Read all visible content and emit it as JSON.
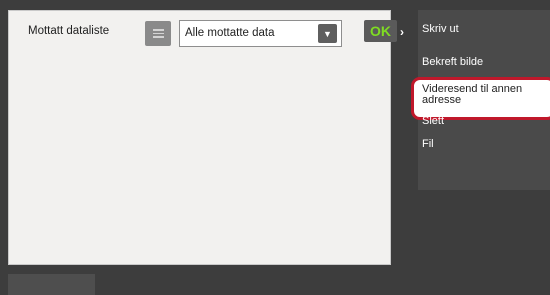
{
  "header": {
    "list_label": "Mottatt dataliste",
    "list_icon": "list-icon",
    "filter_value": "Alle mottatte data",
    "dropdown_icon": "chevron-down-icon",
    "ok_label": "OK"
  },
  "side_menu": {
    "expand_icon": "chevron-right-icon",
    "items": [
      {
        "label": "Skriv ut"
      },
      {
        "label": "Bekreft bilde"
      },
      {
        "label": "Videresend til annen adresse",
        "highlighted": true
      },
      {
        "label": "Slett"
      },
      {
        "label": "Fil"
      }
    ]
  },
  "colors": {
    "background": "#3d3d3d",
    "panel": "#f2f1ef",
    "ok_text": "#7fdc22",
    "highlight_border": "#c0182b"
  }
}
